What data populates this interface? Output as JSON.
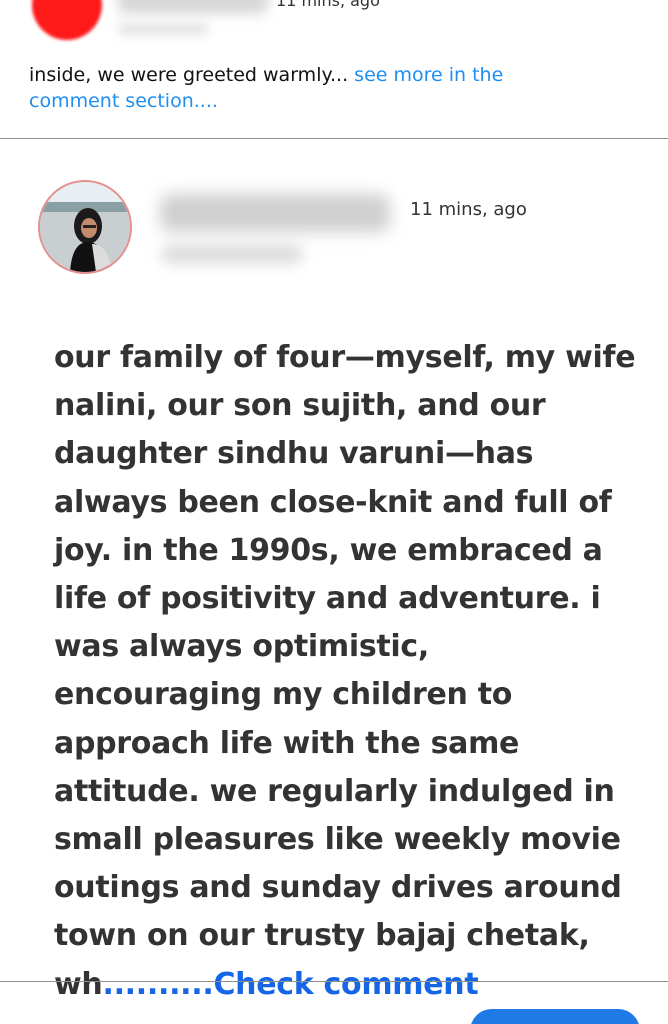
{
  "top_post": {
    "time": "11 mins, ago",
    "text": "inside, we were greeted warmly...",
    "see_more": "see more in the comment section...."
  },
  "post": {
    "time": "11 mins, ago",
    "body": "our family of four—myself, my wife nalini, our son sujith, and our daughter sindhu varuni—has always been close-knit and full of joy. in the 1990s, we embraced a life of positivity and adventure. i was always optimistic, encouraging my children to approach life with the same attitude. we regularly indulged in small pleasures like weekly movie outings and sunday drives around town on our trusty bajaj chetak, wh",
    "check_comment": "..........Check comment"
  },
  "colors": {
    "link": "#1e8ef0",
    "check_comment": "#1565e6",
    "top_avatar": "#ff1a1a",
    "avatar_border": "#e58f8f",
    "button": "#1f7ae6"
  }
}
